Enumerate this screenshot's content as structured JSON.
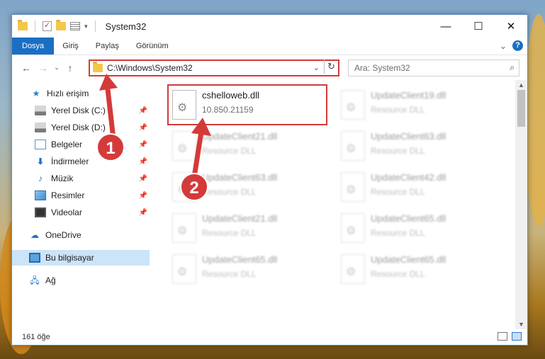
{
  "window": {
    "title": "System32",
    "buttons": {
      "minimize": "—",
      "maximize": "☐",
      "close": "✕"
    }
  },
  "ribbon": {
    "tabs": [
      "Dosya",
      "Giriş",
      "Paylaş",
      "Görünüm"
    ],
    "expand": "⌄",
    "help": "?"
  },
  "nav": {
    "back": "←",
    "forward": "→",
    "recent": "⌄",
    "up": "↑",
    "address": "C:\\Windows\\System32",
    "address_dropdown": "⌄",
    "refresh": "↻",
    "search_placeholder": "Ara: System32",
    "search_icon": "⌕"
  },
  "sidebar": {
    "items": [
      {
        "label": "Hızlı erişim",
        "icon": "star-icon",
        "pinned": false
      },
      {
        "label": "Yerel Disk (C:)",
        "icon": "disk-icon",
        "pinned": true
      },
      {
        "label": "Yerel Disk (D:)",
        "icon": "disk-icon",
        "pinned": true
      },
      {
        "label": "Belgeler",
        "icon": "documents-icon",
        "pinned": true
      },
      {
        "label": "İndirmeler",
        "icon": "download-icon",
        "pinned": true
      },
      {
        "label": "Müzik",
        "icon": "music-icon",
        "pinned": true
      },
      {
        "label": "Resimler",
        "icon": "pictures-icon",
        "pinned": true
      },
      {
        "label": "Videolar",
        "icon": "videos-icon",
        "pinned": true
      },
      {
        "label": "OneDrive",
        "icon": "cloud-icon",
        "pinned": false
      },
      {
        "label": "Bu bilgisayar",
        "icon": "computer-icon",
        "pinned": false,
        "selected": true
      },
      {
        "label": "Ağ",
        "icon": "network-icon",
        "pinned": false
      }
    ],
    "pin_glyph": "📌"
  },
  "files": [
    {
      "name": "cshelloweb.dll",
      "sub": "10.850.21159",
      "highlighted": true
    },
    {
      "name": "UpdateClient19.dll",
      "sub": "Resource DLL"
    },
    {
      "name": "UpdateClient21.dll",
      "sub": "Resource DLL"
    },
    {
      "name": "UpdateClient63.dll",
      "sub": "Resource DLL"
    },
    {
      "name": "UpdateClient63.dll",
      "sub": "Resource DLL"
    },
    {
      "name": "UpdateClient42.dll",
      "sub": "Resource DLL"
    },
    {
      "name": "UpdateClient21.dll",
      "sub": "Resource DLL"
    },
    {
      "name": "UpdateClient65.dll",
      "sub": "Resource DLL"
    },
    {
      "name": "UpdateClient65.dll",
      "sub": "Resource DLL"
    },
    {
      "name": "UpdateClient65.dll",
      "sub": "Resource DLL"
    }
  ],
  "status": {
    "count": "161 öğe"
  },
  "callouts": [
    "1",
    "2"
  ],
  "colors": {
    "accent": "#1a6fc4",
    "highlight": "#d43a3a",
    "selected": "#cce4f7"
  }
}
